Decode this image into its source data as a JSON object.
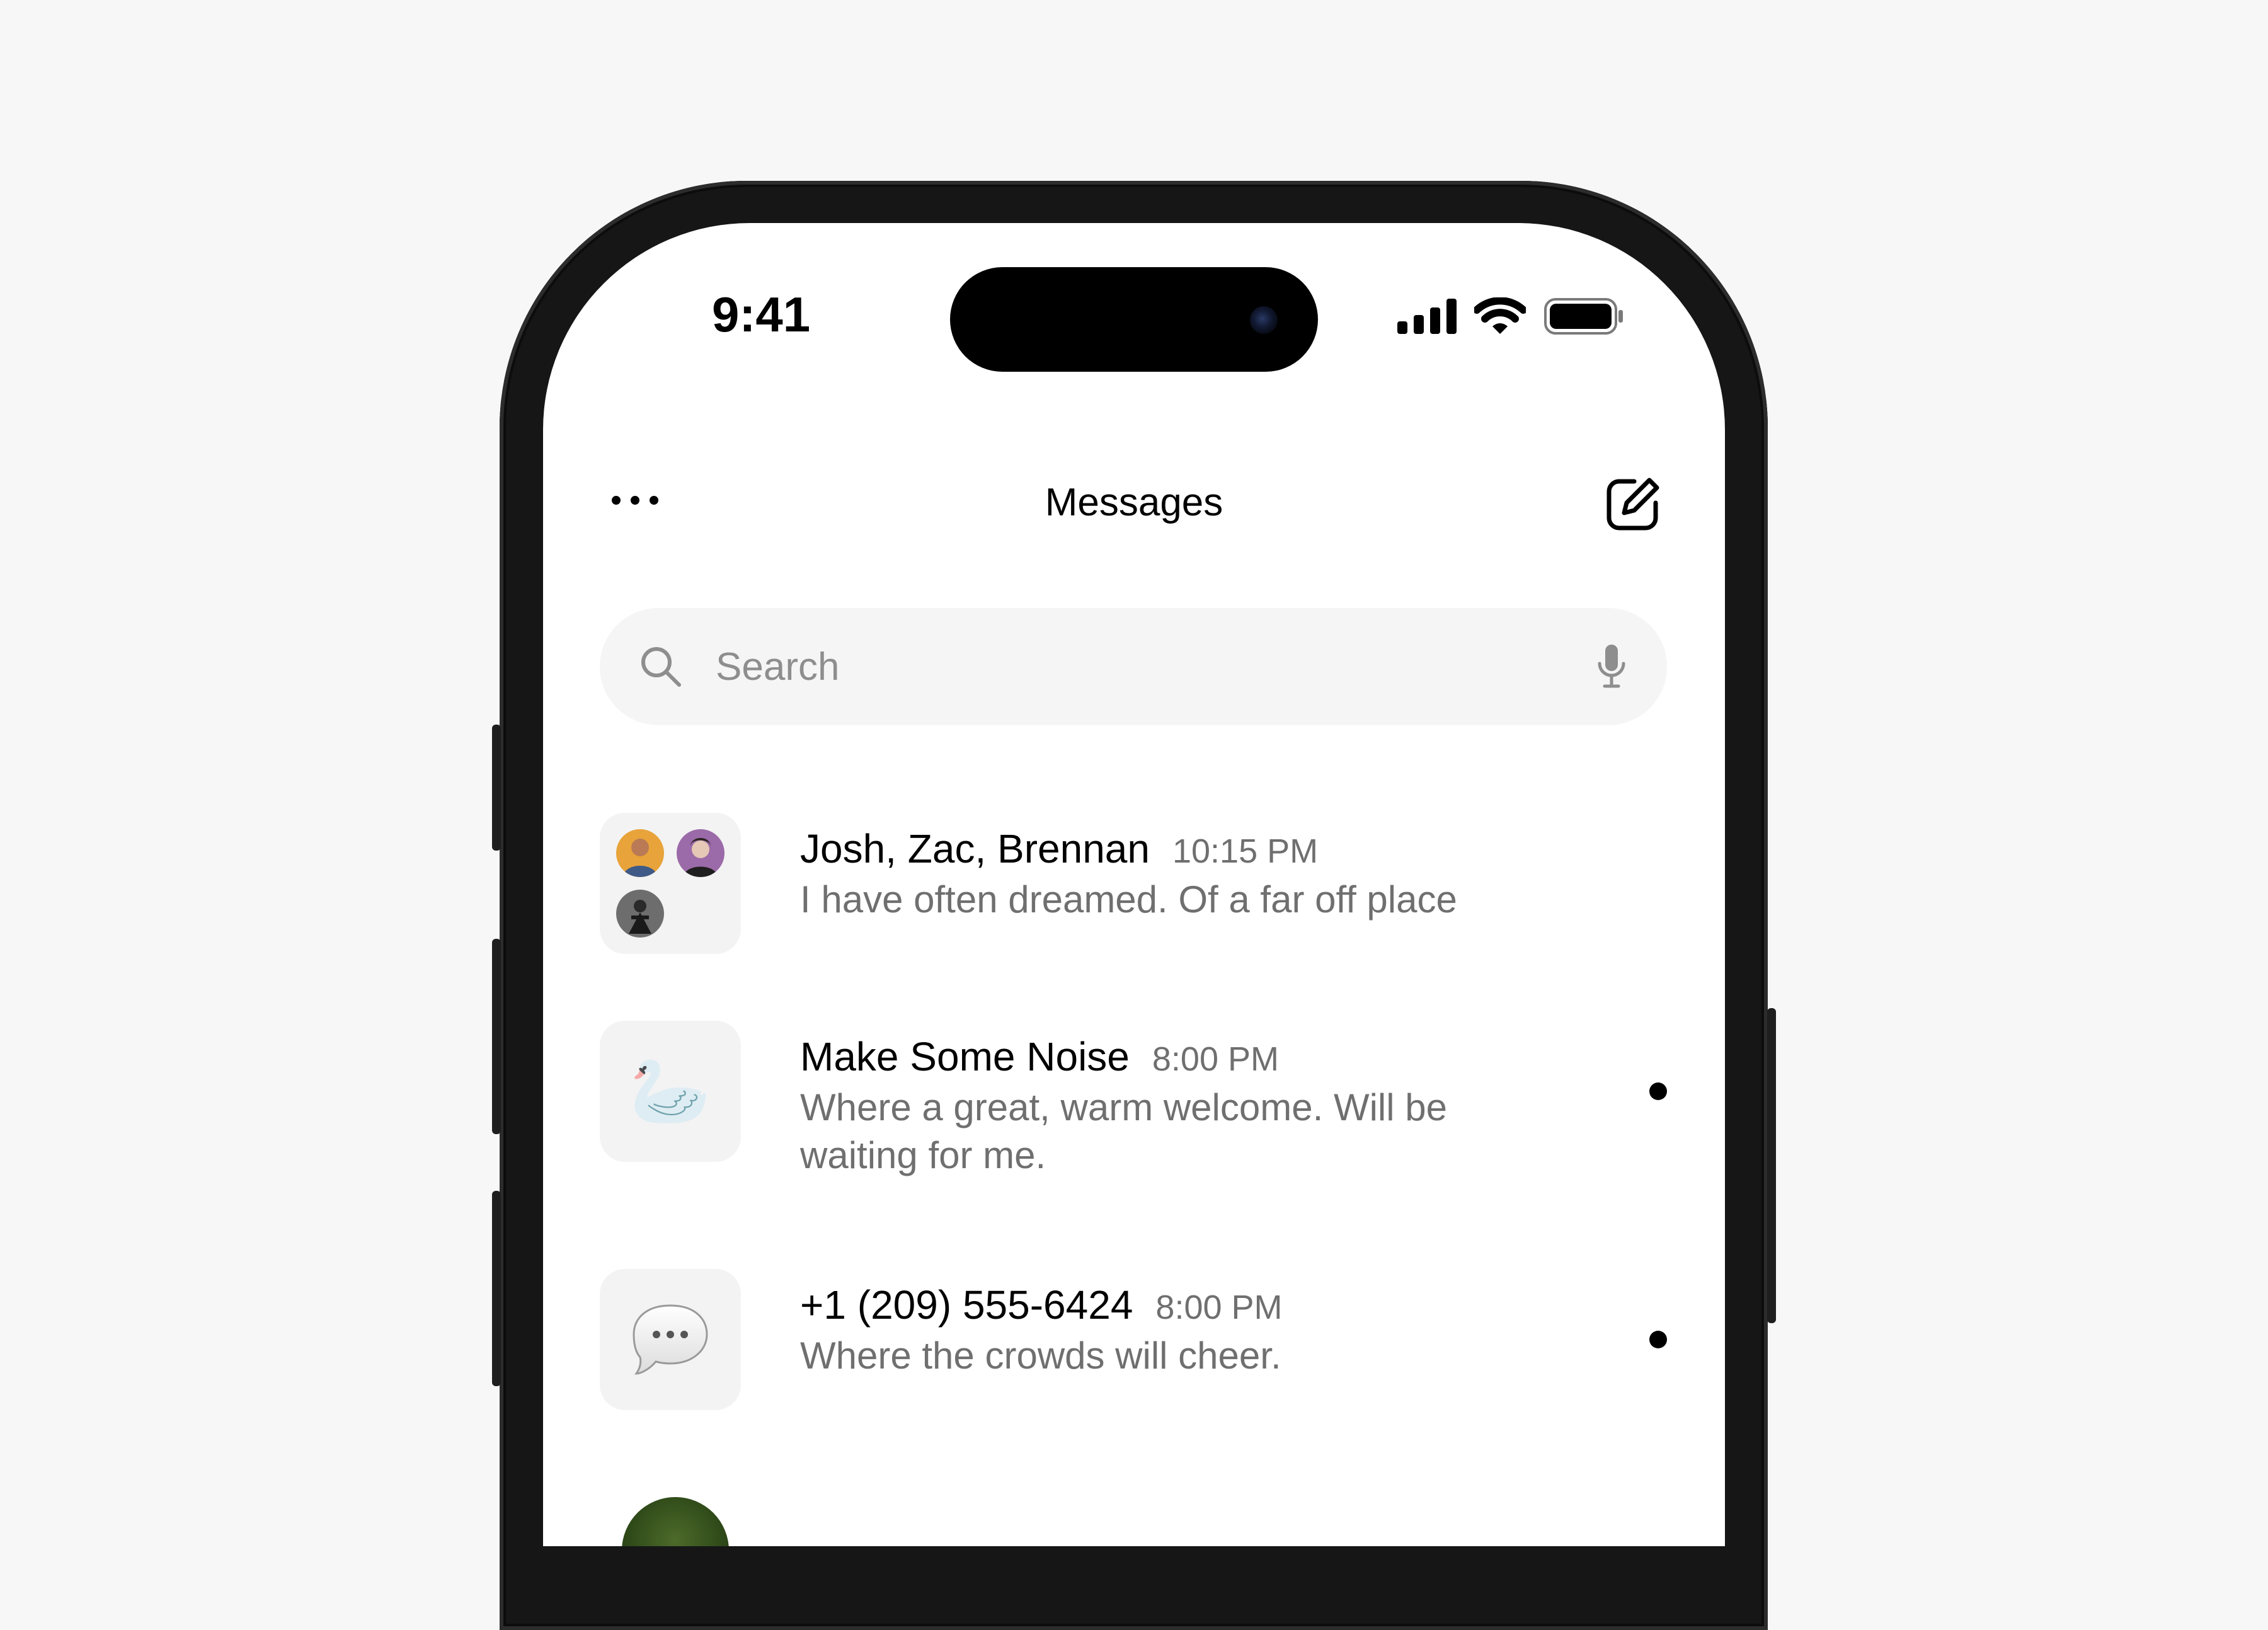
{
  "status_bar": {
    "time": "9:41",
    "icons": [
      "signal-icon",
      "wifi-icon",
      "battery-icon"
    ]
  },
  "header": {
    "title": "Messages",
    "left_icon": "more-icon",
    "right_icon": "compose-icon"
  },
  "search": {
    "placeholder": "Search",
    "icon": "search-icon",
    "mic_icon": "mic-icon"
  },
  "conversations": [
    {
      "name": "Josh, Zac, Brennan",
      "time": "10:15 PM",
      "preview": "I have often dreamed. Of a far off place",
      "avatar": "group-avatar",
      "unread": false
    },
    {
      "name": "Make Some Noise",
      "time": "8:00 PM",
      "preview": "Where a great, warm welcome. Will be waiting for me.",
      "avatar": "goose-emoji",
      "avatar_glyph": "🦢",
      "unread": true
    },
    {
      "name": "+1 (209) 555-6424",
      "time": "8:00 PM",
      "preview": "Where the crowds will cheer.",
      "avatar": "speech-bubble-emoji",
      "unread": true
    }
  ],
  "colors": {
    "page_background": "#f7f7f7",
    "screen_background": "#ffffff",
    "secondary_text": "#6f6f6f",
    "search_background": "#f5f5f5",
    "frame": "#161616"
  }
}
